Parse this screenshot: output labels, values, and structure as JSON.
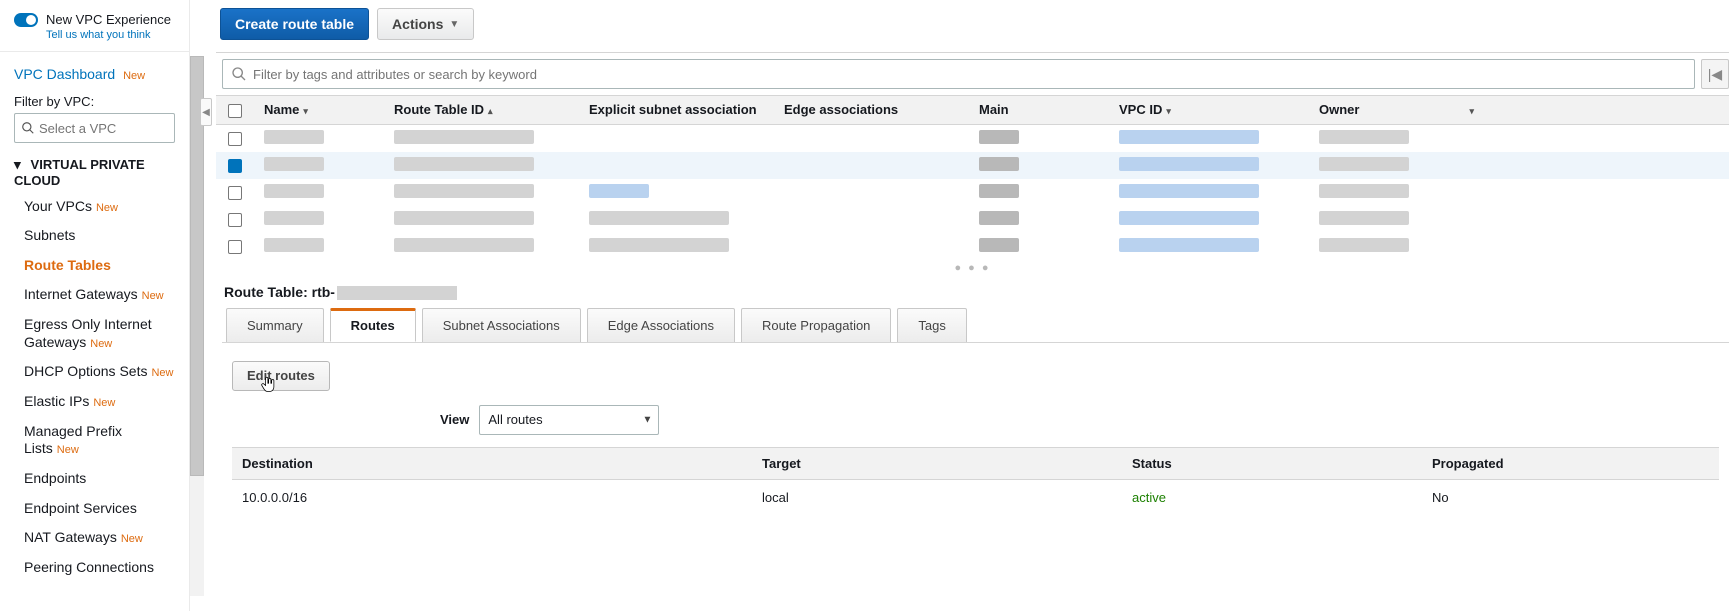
{
  "sidebar": {
    "new_experience_label": "New VPC Experience",
    "tell_us": "Tell us what you think",
    "dashboard": "VPC Dashboard",
    "dashboard_new": "New",
    "filter_label": "Filter by VPC:",
    "filter_placeholder": "Select a VPC",
    "section": "VIRTUAL PRIVATE CLOUD",
    "items": [
      {
        "label": "Your VPCs",
        "new": true,
        "active": false
      },
      {
        "label": "Subnets",
        "new": false,
        "active": false
      },
      {
        "label": "Route Tables",
        "new": false,
        "active": true
      },
      {
        "label": "Internet Gateways",
        "new": true,
        "active": false
      },
      {
        "label": "Egress Only Internet Gateways",
        "new": true,
        "active": false
      },
      {
        "label": "DHCP Options Sets",
        "new": true,
        "active": false
      },
      {
        "label": "Elastic IPs",
        "new": true,
        "active": false
      },
      {
        "label": "Managed Prefix Lists",
        "new": true,
        "active": false
      },
      {
        "label": "Endpoints",
        "new": false,
        "active": false
      },
      {
        "label": "Endpoint Services",
        "new": false,
        "active": false
      },
      {
        "label": "NAT Gateways",
        "new": true,
        "active": false
      },
      {
        "label": "Peering Connections",
        "new": false,
        "active": false
      }
    ]
  },
  "toolbar": {
    "create": "Create route table",
    "actions": "Actions"
  },
  "filter_placeholder": "Filter by tags and attributes or search by keyword",
  "columns": {
    "name": "Name",
    "rt_id": "Route Table ID",
    "explicit": "Explicit subnet association",
    "edge": "Edge associations",
    "main": "Main",
    "vpc_id": "VPC ID",
    "owner": "Owner"
  },
  "rows": [
    {
      "selected": false
    },
    {
      "selected": true
    },
    {
      "selected": false
    },
    {
      "selected": false
    },
    {
      "selected": false
    }
  ],
  "details": {
    "title_prefix": "Route Table: rtb-",
    "tabs": {
      "summary": "Summary",
      "routes": "Routes",
      "subnet": "Subnet Associations",
      "edge": "Edge Associations",
      "prop": "Route Propagation",
      "tags": "Tags"
    },
    "edit_routes": "Edit routes",
    "view_label": "View",
    "view_value": "All routes",
    "route_cols": {
      "dest": "Destination",
      "target": "Target",
      "status": "Status",
      "propagated": "Propagated"
    },
    "route_rows": [
      {
        "dest": "10.0.0.0/16",
        "target": "local",
        "status": "active",
        "propagated": "No"
      }
    ]
  }
}
